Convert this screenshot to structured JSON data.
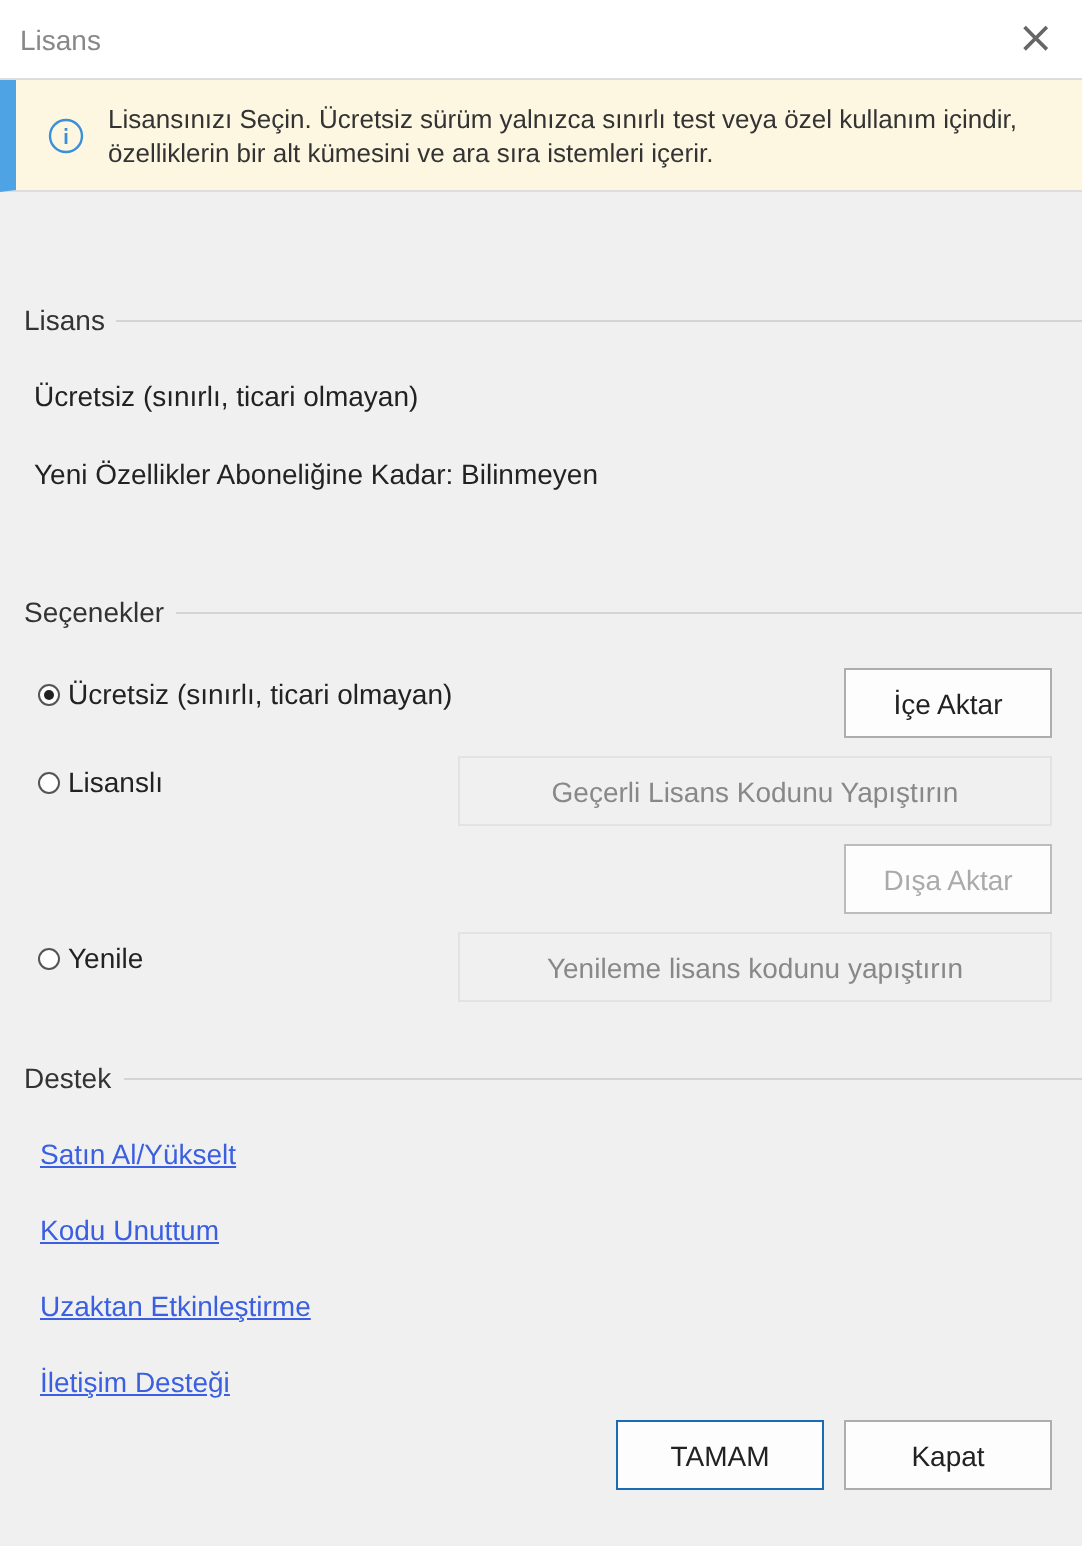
{
  "window": {
    "title": "Lisans",
    "close": "×"
  },
  "banner": {
    "text": "Lisansınızı Seçin. Ücretsiz sürüm yalnızca sınırlı test veya özel kullanım içindir, özelliklerin bir alt kümesini ve ara sıra istemleri içerir."
  },
  "license": {
    "heading": "Lisans",
    "lines": [
      "Ücretsiz (sınırlı, ticari olmayan)",
      "Yeni Özellikler Aboneliğine Kadar: Bilinmeyen"
    ]
  },
  "options": {
    "heading": "Seçenekler",
    "rows": [
      {
        "radio": {
          "label": "Ücretsiz (sınırlı, ticari olmayan)",
          "selected": true
        },
        "button": {
          "label": "İçe Aktar",
          "kind": "small",
          "disabled": false
        }
      },
      {
        "radio": {
          "label": "Lisanslı",
          "selected": false
        },
        "button": {
          "label": "Geçerli Lisans Kodunu Yapıştırın",
          "kind": "wide",
          "disabled": true
        }
      },
      {
        "button": {
          "label": "Dışa Aktar",
          "kind": "small",
          "disabled": true
        }
      },
      {
        "radio": {
          "label": "Yenile",
          "selected": false
        },
        "button": {
          "label": "Yenileme lisans kodunu yapıştırın",
          "kind": "wide",
          "disabled": true
        }
      }
    ]
  },
  "support": {
    "heading": "Destek",
    "links": [
      "Satın Al/Yükselt",
      "Kodu Unuttum",
      "Uzaktan Etkinleştirme",
      "İletişim Desteği"
    ]
  },
  "buttons": [
    {
      "label": "TAMAM",
      "default": true
    },
    {
      "label": "Kapat",
      "default": false
    }
  ]
}
